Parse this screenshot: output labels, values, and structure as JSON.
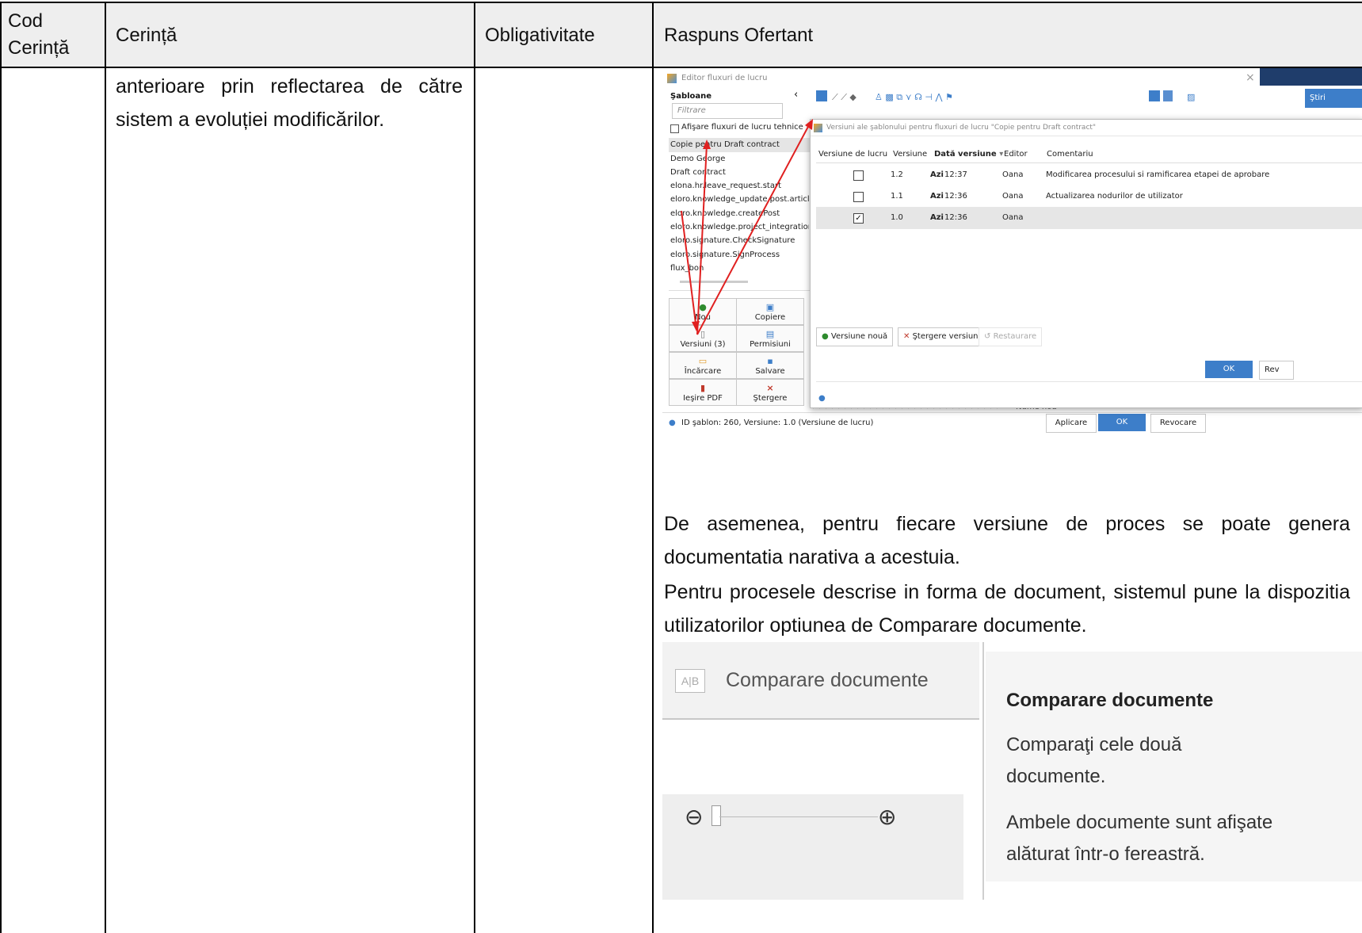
{
  "table": {
    "headers": {
      "code": "Cod Cerință",
      "requirement": "Cerință",
      "mandatory": "Obligativitate",
      "response": "Raspuns Ofertant"
    },
    "requirement_text": "anterioare prin reflectarea de către sistem a evoluției modificărilor.",
    "response_paragraph_1": "De asemenea, pentru fiecare versiune de proces se poate genera documentatia narativa a acestuia.",
    "response_paragraph_2": "Pentru procesele descrise in forma de document, sistemul pune la dispozitia utilizatorilor optiunea de Comparare documente."
  },
  "workflow_editor": {
    "window_title": "Editor fluxuri de lucru",
    "templates_heading": "Şabloane",
    "filter_placeholder": "Filtrare",
    "show_technical_label": "Afişare fluxuri de lucru tehnice",
    "templates": [
      "Copie pentru Draft contract",
      "Demo George",
      "Draft contract",
      "elona.hr.leave_request.start",
      "eloro.knowledge_update.post.article.r",
      "eloro.knowledge.createPost",
      "eloro.knowledge.project_integration.w",
      "eloro.signature.CheckSignature",
      "eloro.signature.SignProcess",
      "flux_bon"
    ],
    "buttons": {
      "new": "Nou",
      "copy": "Copiere",
      "versions": "Versiuni (3)",
      "permissions": "Permisiuni",
      "load": "Încărcare",
      "save": "Salvare",
      "export_pdf": "Ieşire PDF",
      "delete": "Ştergere"
    },
    "status_text": "ID şablon: 260, Versiune: 1.0 (Versiune de lucru)",
    "footer_buttons": {
      "apply": "Aplicare",
      "ok": "OK",
      "revoke": "Revocare"
    },
    "top_right_button": "Ştiri",
    "canvas_label": "Nume nod"
  },
  "versions_dialog": {
    "title": "Versiuni ale şablonului pentru fluxuri de lucru \"Copie pentru Draft contract\"",
    "columns": [
      "Versiune de lucru",
      "Versiune",
      "Dată versiune",
      "Editor",
      "Comentariu"
    ],
    "rows": [
      {
        "checked": false,
        "version": "1.2",
        "date_bold": "Azi",
        "time": "12:37",
        "editor": "Oana",
        "comment": "Modificarea procesului si ramificarea etapei de aprobare"
      },
      {
        "checked": false,
        "version": "1.1",
        "date_bold": "Azi",
        "time": "12:36",
        "editor": "Oana",
        "comment": "Actualizarea nodurilor de utilizator"
      },
      {
        "checked": true,
        "version": "1.0",
        "date_bold": "Azi",
        "time": "12:36",
        "editor": "Oana",
        "comment": ""
      }
    ],
    "buttons": {
      "new_version": "Versiune nouă",
      "delete_version": "Ştergere versiune",
      "restore": "Restaurare",
      "ok": "OK",
      "revoke": "Rev"
    }
  },
  "compare_panel": {
    "ribbon_icon": "A|B compare icon",
    "ribbon_label": "Comparare documente",
    "tooltip_title": "Comparare documente",
    "tooltip_line_1": "Comparaţi cele două documente.",
    "tooltip_line_2": "Ambele documente sunt afişate alăturat într-o fereastră."
  },
  "colors": {
    "accent_blue": "#3d7ec9",
    "red_arrow": "#e02020",
    "header_bg": "#eeeeee",
    "dark_navy": "#1f3d6b"
  }
}
